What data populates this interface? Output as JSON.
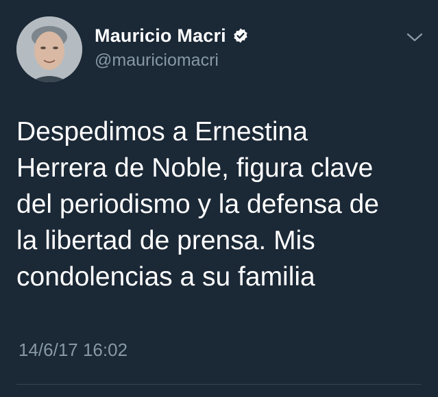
{
  "user": {
    "display_name": "Mauricio Macri",
    "handle": "@mauriciomacri",
    "verified": true,
    "avatar_icon": "profile-photo"
  },
  "tweet": {
    "text": "Despedimos a Ernestina\nHerrera de Noble, figura clave\ndel periodismo y la defensa de\nla libertad de prensa. Mis\ncondolencias a su familia",
    "timestamp": "14/6/17 16:02"
  },
  "icons": {
    "verified": "verified-badge-icon",
    "menu": "chevron-down-icon"
  },
  "colors": {
    "background": "#1b2836",
    "text_primary": "#ffffff",
    "text_secondary": "#8899a6",
    "divider": "#38444d"
  }
}
